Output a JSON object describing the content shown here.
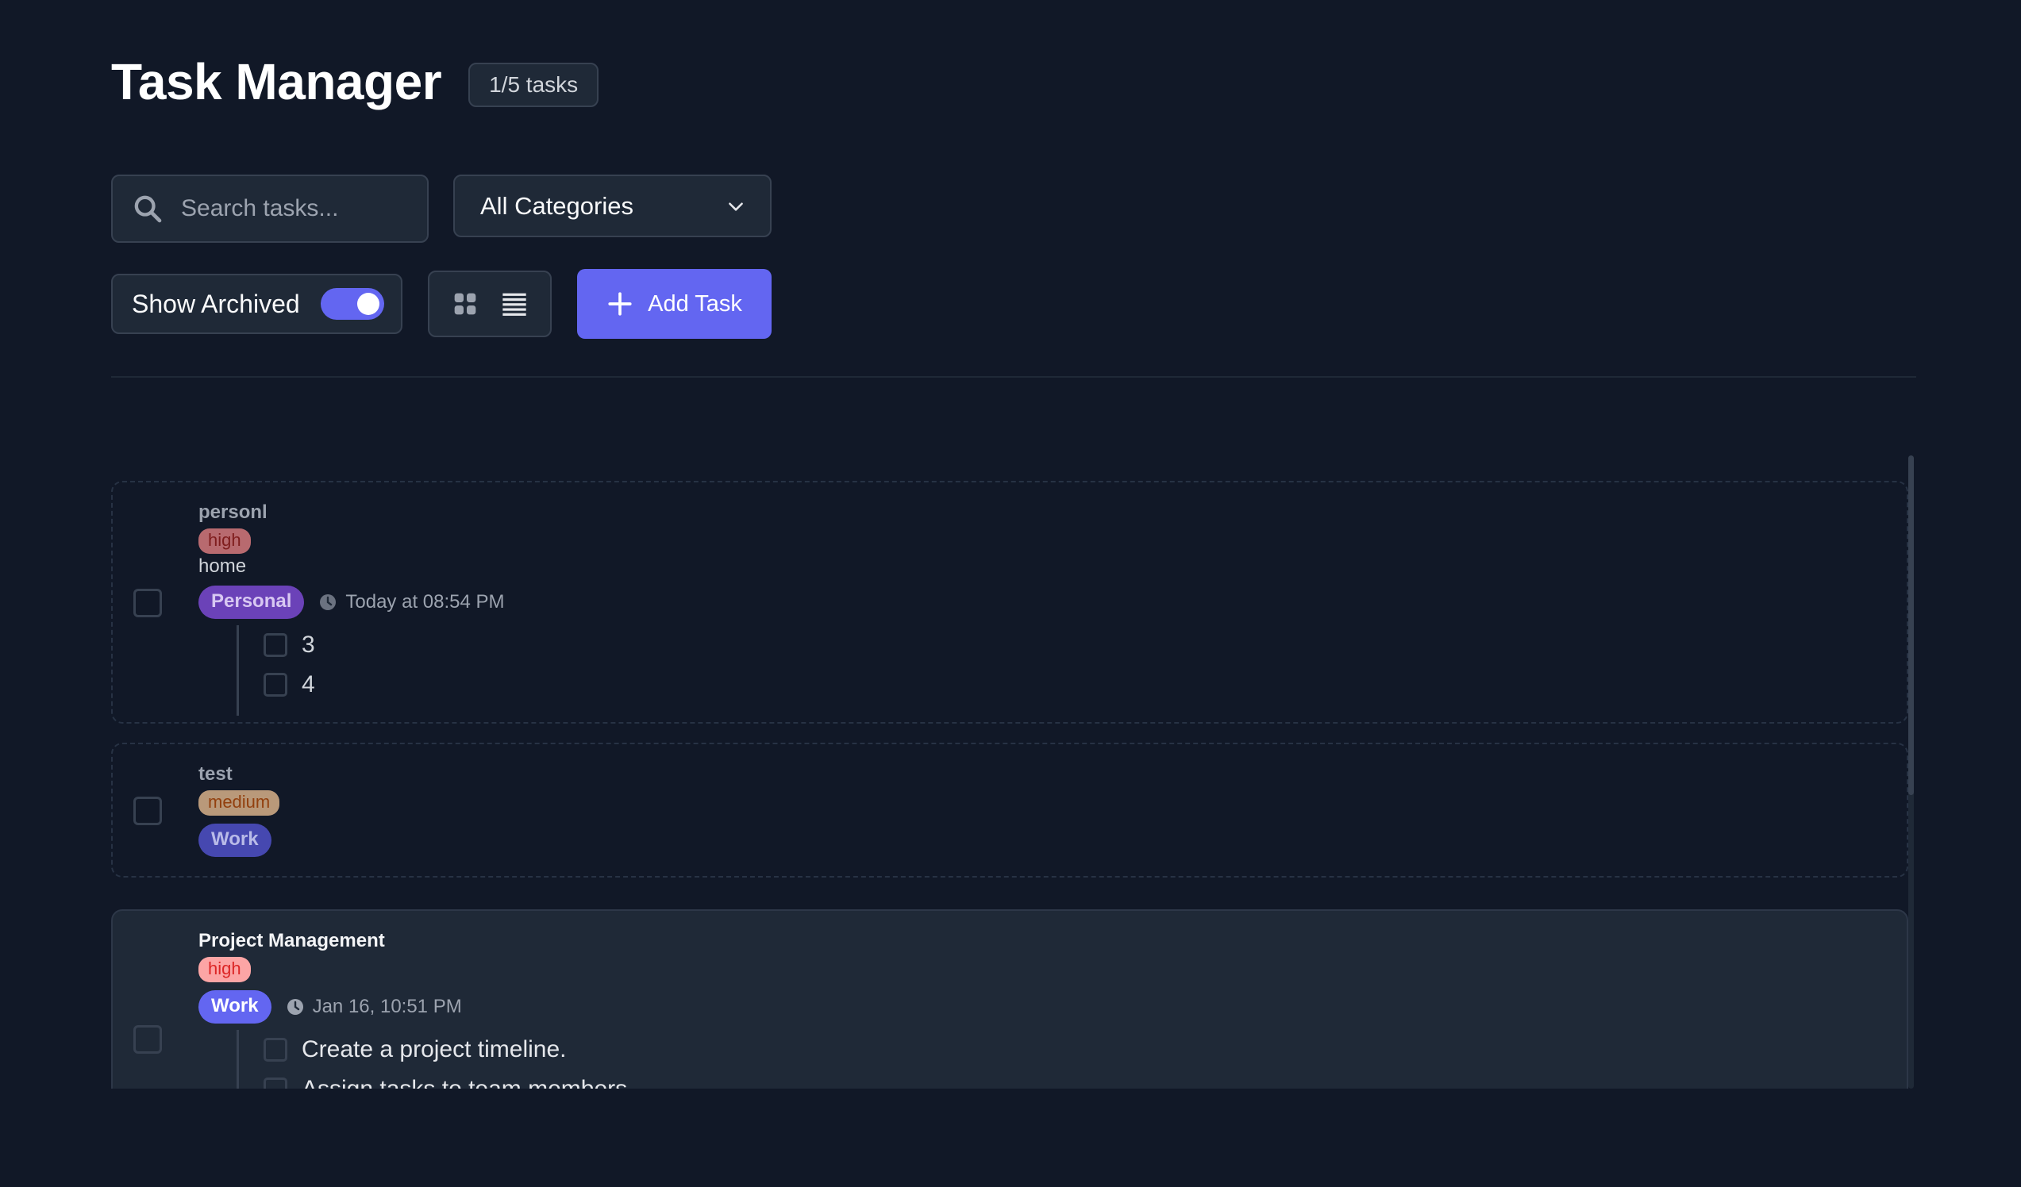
{
  "header": {
    "title": "Task Manager",
    "count": "1/5 tasks"
  },
  "filters": {
    "search_placeholder": "Search tasks...",
    "category_selected": "All Categories",
    "show_archived_label": "Show Archived",
    "show_archived_on": true,
    "add_task_label": "Add Task"
  },
  "colors": {
    "background": "#111827",
    "surface": "#1f2937",
    "accent": "#6366f1"
  },
  "tasks": [
    {
      "title": "personl",
      "priority": "high",
      "description": "home",
      "category": "Personal",
      "due": "Today at 08:54 PM",
      "archived": true,
      "subtasks": [
        "3",
        "4"
      ]
    },
    {
      "title": "test",
      "priority": "medium",
      "description": "",
      "category": "Work",
      "due": "",
      "archived": true,
      "subtasks": []
    },
    {
      "title": "Project Management",
      "priority": "high",
      "description": "",
      "category": "Work",
      "due": "Jan 16, 10:51 PM",
      "archived": false,
      "subtasks": [
        "Create a project timeline.",
        "Assign tasks to team members."
      ]
    }
  ]
}
